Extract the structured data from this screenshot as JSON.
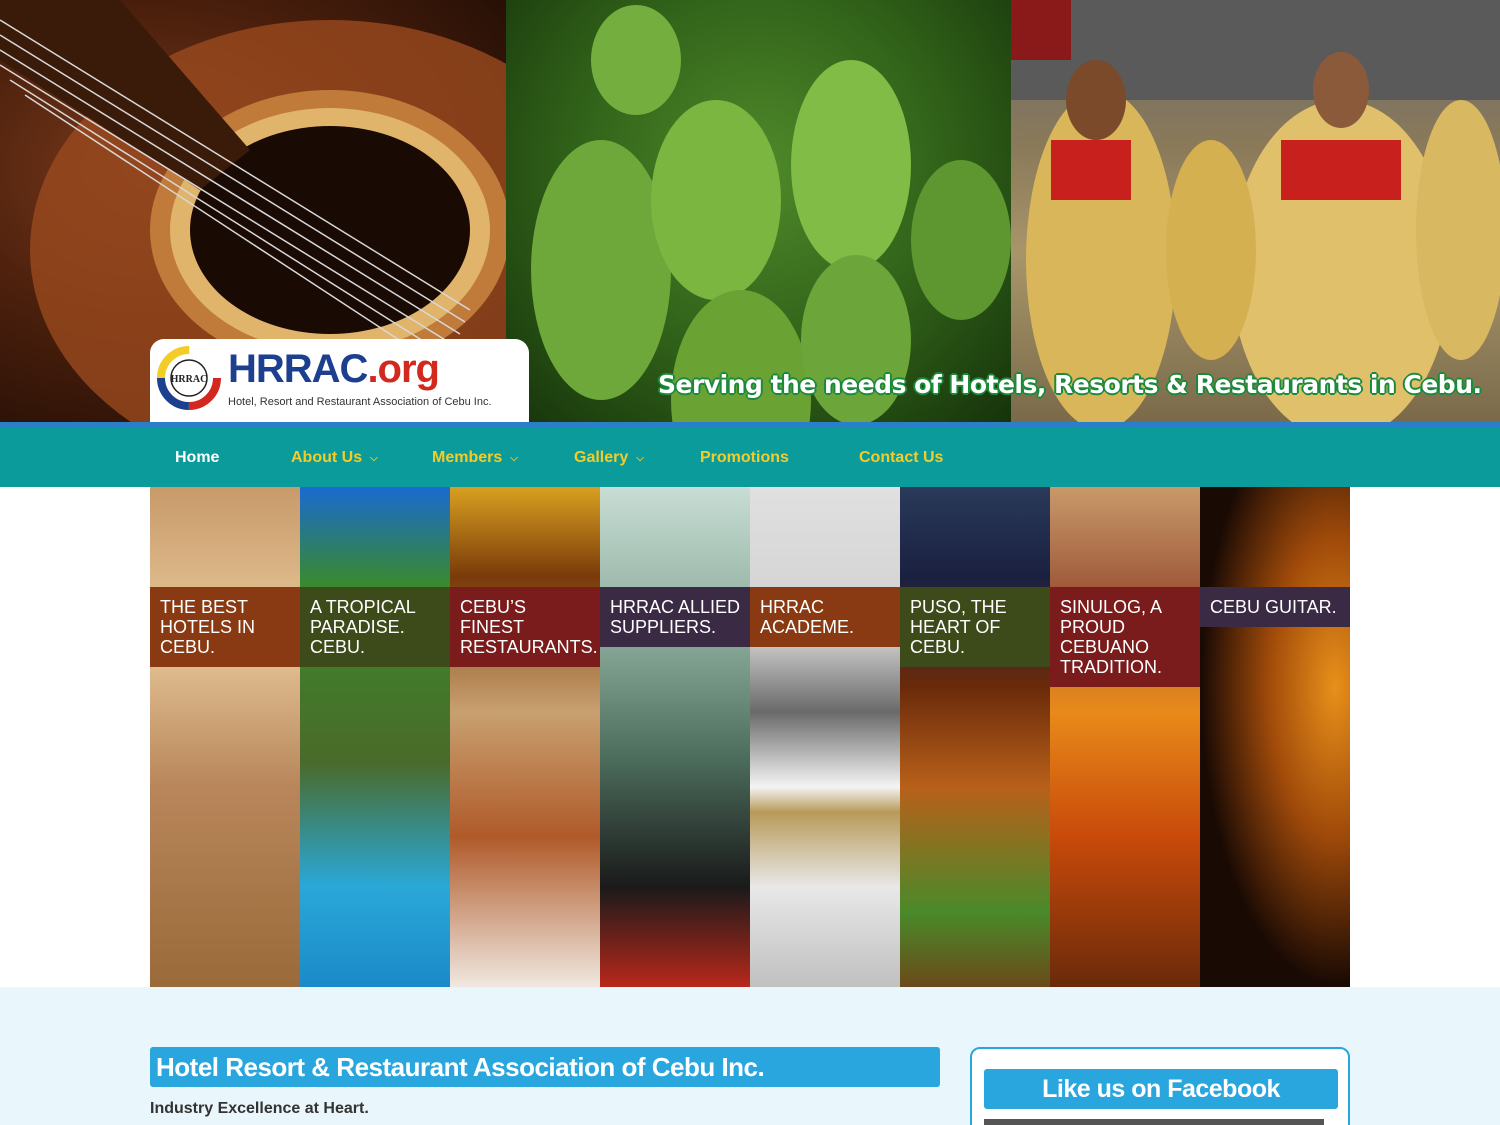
{
  "hero": {
    "logo_title_main": "HRRAC",
    "logo_title_ext": ".org",
    "logo_subtitle": "Hotel, Resort and Restaurant Association of Cebu Inc.",
    "logo_emblem_text": "HRRAC",
    "tagline": "Serving the needs of Hotels, Resorts & Restaurants in Cebu."
  },
  "nav": {
    "items": [
      {
        "label": "Home",
        "active": true
      },
      {
        "label": "About Us",
        "dropdown": true
      },
      {
        "label": "Members",
        "dropdown": true
      },
      {
        "label": "Gallery",
        "dropdown": true
      },
      {
        "label": "Promotions"
      },
      {
        "label": "Contact Us"
      }
    ],
    "dropdown_icon": "chevron-down-icon"
  },
  "slider": {
    "slides": [
      {
        "caption": "THE BEST HOTELS IN CEBU.",
        "color": "#8a3a12"
      },
      {
        "caption": "A TROPICAL PARADISE. CEBU.",
        "color": "#3d4a1a"
      },
      {
        "caption": "CEBU’S FINEST RESTAURANTS.",
        "color": "#7a1c1c"
      },
      {
        "caption": "HRRAC ALLIED SUPPLIERS.",
        "color": "#3a2a44"
      },
      {
        "caption": "HRRAC ACADEME.",
        "color": "#8a3a12"
      },
      {
        "caption": "PUSO, THE HEART OF CEBU.",
        "color": "#3d4a1a"
      },
      {
        "caption": "SINULOG, A PROUD CEBUANO TRADITION.",
        "color": "#7a1c1c"
      },
      {
        "caption": "CEBU GUITAR.",
        "color": "#3a2a44"
      }
    ]
  },
  "main": {
    "title": "Hotel Resort & Restaurant Association of Cebu Inc.",
    "subtitle": "Industry Excellence at Heart."
  },
  "sidebar": {
    "facebook_title": "Like us on Facebook"
  },
  "colors": {
    "nav_bg": "#0b9b9b",
    "nav_text": "#f4cc27",
    "accent_blue": "#2aa6df",
    "content_bg": "#e9f6fb"
  }
}
